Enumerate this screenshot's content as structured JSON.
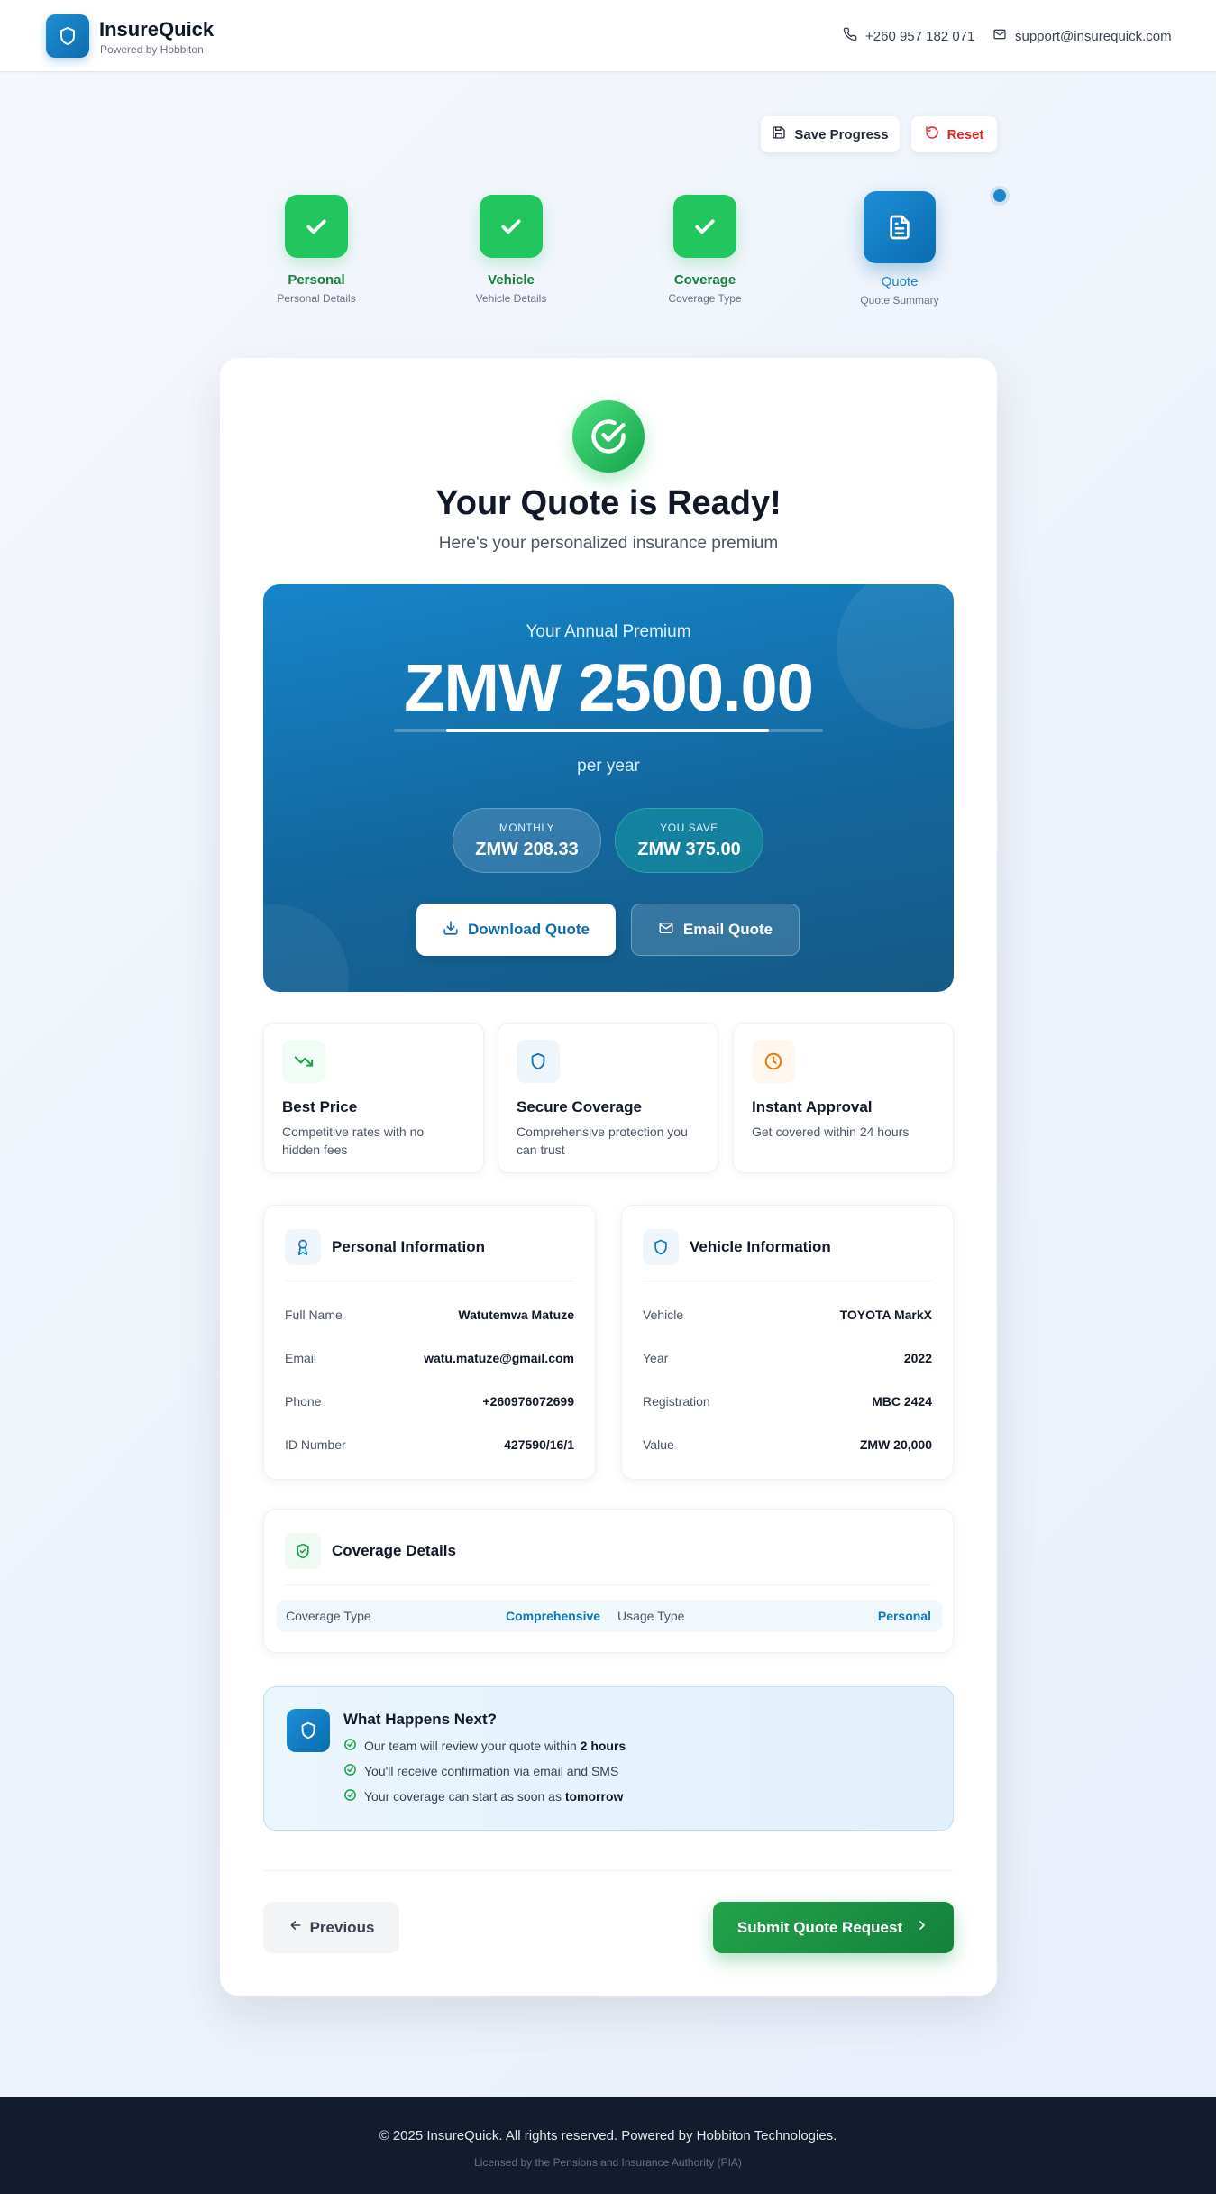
{
  "header": {
    "brand_name": "InsureQuick",
    "brand_sub": "Powered by Hobbiton",
    "phone": "+260 957 182 071",
    "email": "support@insurequick.com"
  },
  "actions": {
    "save_label": "Save Progress",
    "reset_label": "Reset"
  },
  "steps": [
    {
      "label": "Personal",
      "sub": "Personal Details",
      "status": "complete"
    },
    {
      "label": "Vehicle",
      "sub": "Vehicle Details",
      "status": "complete"
    },
    {
      "label": "Coverage",
      "sub": "Coverage Type",
      "status": "complete"
    },
    {
      "label": "Quote",
      "sub": "Quote Summary",
      "status": "active"
    }
  ],
  "quote": {
    "title": "Your Quote is Ready!",
    "subtitle": "Here's your personalized insurance premium",
    "premium_label": "Your Annual Premium",
    "premium_amount": "ZMW 2500.00",
    "per": "per year",
    "monthly_label": "MONTHLY",
    "monthly_value": "ZMW 208.33",
    "save_label": "YOU SAVE",
    "save_value": "ZMW 375.00",
    "download_label": "Download Quote",
    "email_label": "Email Quote"
  },
  "features": [
    {
      "title": "Best Price",
      "desc": "Competitive rates with no hidden fees",
      "icon": "trending-down-icon"
    },
    {
      "title": "Secure Coverage",
      "desc": "Comprehensive protection you can trust",
      "icon": "shield-icon"
    },
    {
      "title": "Instant Approval",
      "desc": "Get covered within 24 hours",
      "icon": "clock-icon"
    }
  ],
  "personal": {
    "title": "Personal Information",
    "rows": [
      {
        "k": "Full Name",
        "v": "Watutemwa Matuze"
      },
      {
        "k": "Email",
        "v": "watu.matuze@gmail.com"
      },
      {
        "k": "Phone",
        "v": "+260976072699"
      },
      {
        "k": "ID Number",
        "v": "427590/16/1"
      }
    ]
  },
  "vehicle": {
    "title": "Vehicle Information",
    "rows": [
      {
        "k": "Vehicle",
        "v": "TOYOTA MarkX"
      },
      {
        "k": "Year",
        "v": "2022"
      },
      {
        "k": "Registration",
        "v": "MBC 2424"
      },
      {
        "k": "Value",
        "v": "ZMW 20,000"
      }
    ]
  },
  "coverage": {
    "title": "Coverage Details",
    "type_label": "Coverage Type",
    "type_value": "Comprehensive",
    "usage_label": "Usage Type",
    "usage_value": "Personal"
  },
  "next": {
    "title": "What Happens Next?",
    "item1_pre": "Our team will review your quote within ",
    "item1_bold": "2 hours",
    "item2": "You'll receive confirmation via email and SMS",
    "item3_pre": "Your coverage can start as soon as ",
    "item3_bold": "tomorrow"
  },
  "nav": {
    "previous_label": "Previous",
    "submit_label": "Submit Quote Request"
  },
  "footer": {
    "copyright": "© 2025 InsureQuick. All rights reserved. Powered by Hobbiton Technologies.",
    "license": "Licensed by the Pensions and Insurance Authority (PIA)"
  },
  "colors": {
    "primary": "#0b6cb0",
    "success": "#22c55e",
    "danger": "#dc2626",
    "footer": "#131b2e"
  }
}
